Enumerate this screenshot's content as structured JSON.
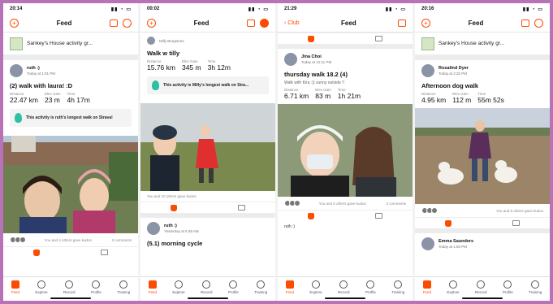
{
  "phones": [
    {
      "time": "20:14",
      "nav_title": "Feed",
      "club": "Sankey's House activity gr...",
      "athlete": "ruth :)",
      "meta": "Today at 1:01 PM",
      "title": "(2) walk with laura! :D",
      "stats": [
        {
          "label": "Distance",
          "value": "22.47 km"
        },
        {
          "label": "Elev Gain",
          "value": "23 m"
        },
        {
          "label": "Time",
          "value": "4h 17m"
        }
      ],
      "achievement": "This activity is ruth's longest walk on Strava!",
      "kudos": "You and 4 others gave kudos",
      "comments": "2 comments"
    },
    {
      "time": "00:02",
      "nav_title": "Feed",
      "top_athlete": "Milly Bergstone",
      "title": "Walk w tilly",
      "stats": [
        {
          "label": "Distance",
          "value": "15.76 km"
        },
        {
          "label": "Elev Gain",
          "value": "345 m"
        },
        {
          "label": "Time",
          "value": "3h 12m"
        }
      ],
      "achievement": "This activity is Milly's longest walk on Stra...",
      "kudos": "You and 10 others gave kudos",
      "athlete2": "ruth :)",
      "meta2": "Yesterday at 6:48 AM",
      "title2": "(5.1) morning cycle"
    },
    {
      "time": "21:29",
      "back": "Club",
      "nav_title": "Feed",
      "athlete": "Jina Choi",
      "meta": "Today at 12:11 PM",
      "title": "thursday walk 18.2 (4)",
      "desc": "Walk with Kira :)) sunny outside !!",
      "stats": [
        {
          "label": "Distance",
          "value": "6.71 km"
        },
        {
          "label": "Elev Gain",
          "value": "83 m"
        },
        {
          "label": "Time",
          "value": "1h 21m"
        }
      ],
      "kudos": "You and 6 others gave kudos",
      "comments": "2 comments",
      "comment_author": "ruth :)"
    },
    {
      "time": "20:16",
      "nav_title": "Feed",
      "club": "Sankey's House activity gr...",
      "athlete": "Rosalind Dyer",
      "meta": "Today at 2:32 PM",
      "title": "Afternoon dog walk",
      "stats": [
        {
          "label": "Distance",
          "value": "4.95 km"
        },
        {
          "label": "Elev Gain",
          "value": "112 m"
        },
        {
          "label": "Time",
          "value": "55m 52s"
        }
      ],
      "kudos": "You and 8 others gave kudos",
      "athlete2": "Emma Saunders",
      "meta2": "Today at 1:50 PM"
    }
  ],
  "tabs": [
    "Feed",
    "Explore",
    "Record",
    "Profile",
    "Training"
  ],
  "colors": {
    "accent": "#fc4c02",
    "border": "#b873b8"
  }
}
